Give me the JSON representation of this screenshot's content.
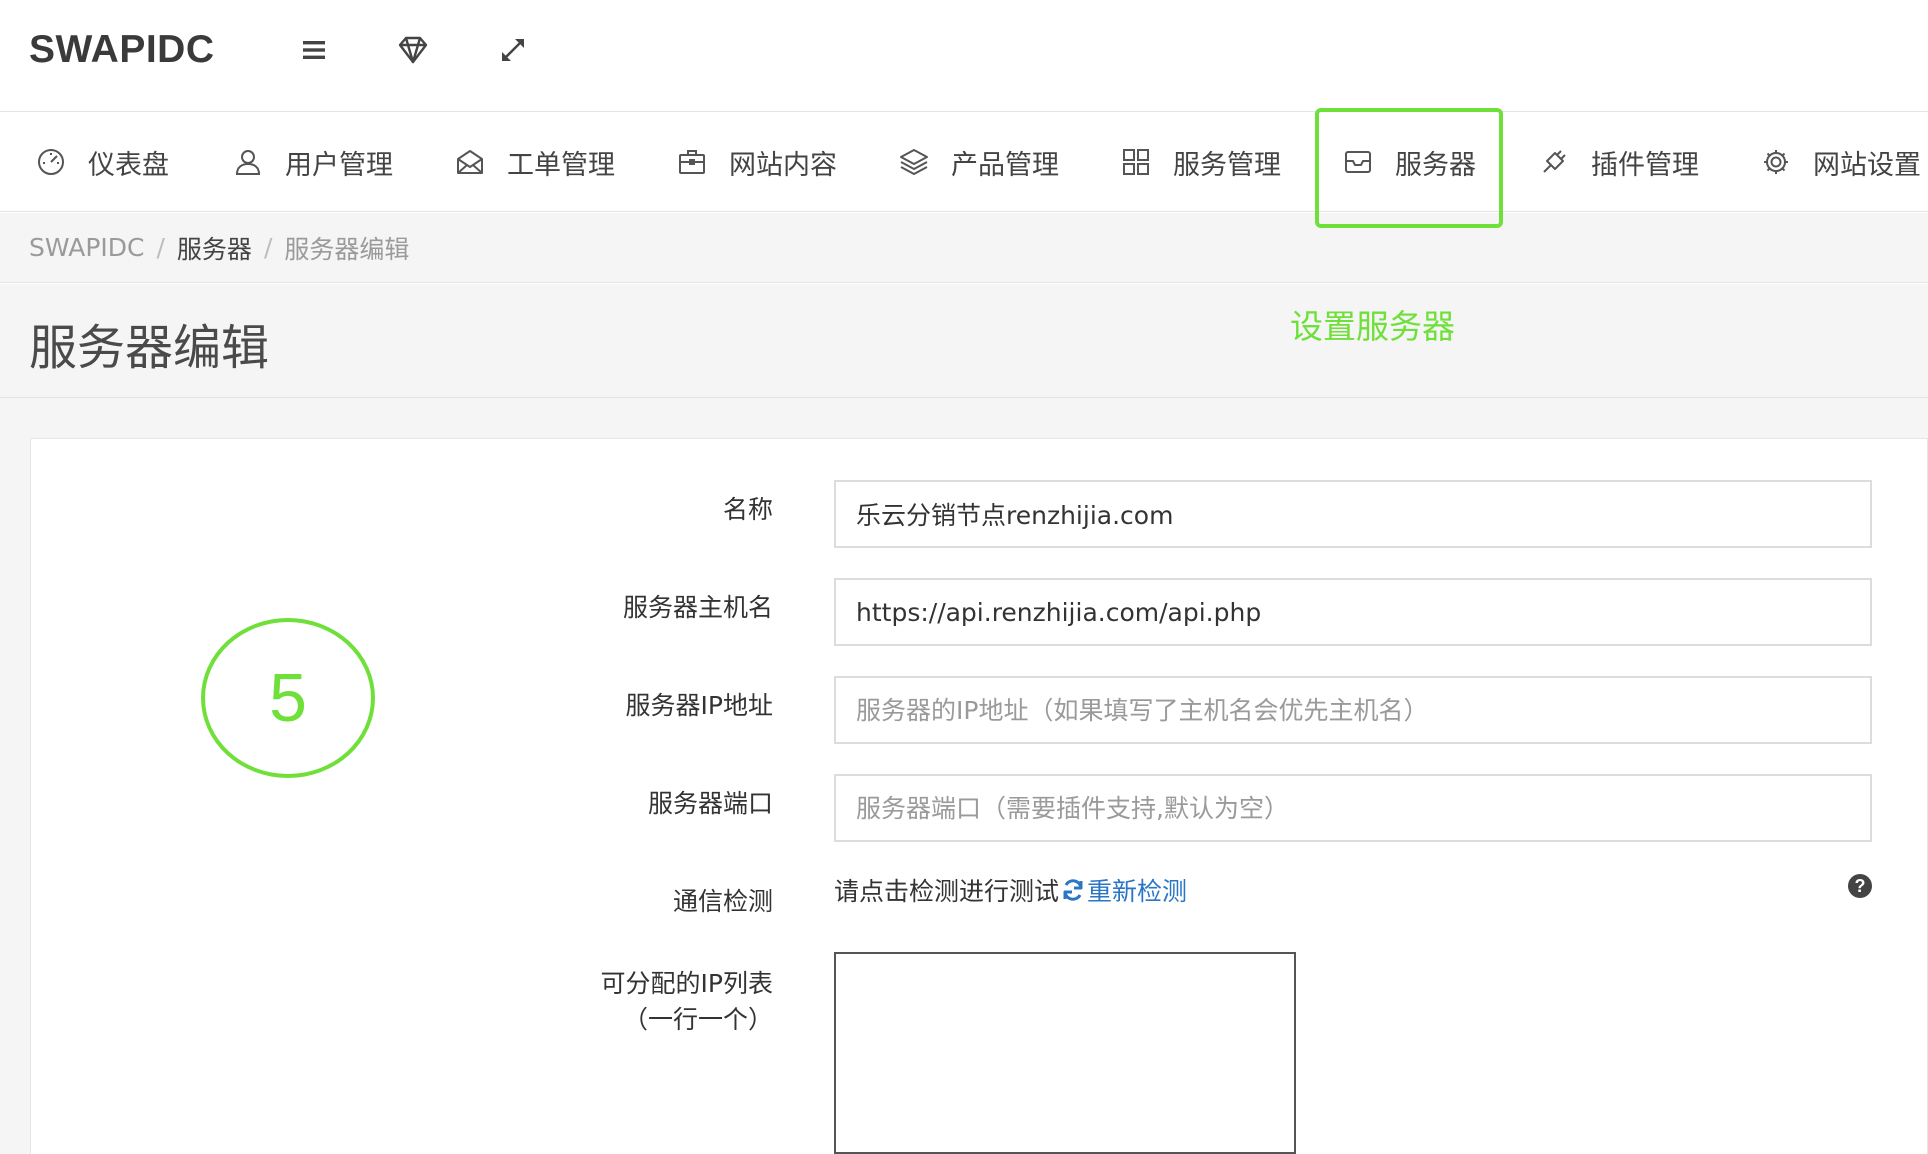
{
  "header": {
    "brand": "SWAPIDC",
    "icons": [
      "menu-icon",
      "diamond-icon",
      "expand-icon"
    ]
  },
  "nav": {
    "items": [
      {
        "label": "仪表盘",
        "icon": "dashboard-icon"
      },
      {
        "label": "用户管理",
        "icon": "user-icon"
      },
      {
        "label": "工单管理",
        "icon": "envelope-icon"
      },
      {
        "label": "网站内容",
        "icon": "briefcase-icon"
      },
      {
        "label": "产品管理",
        "icon": "layers-icon"
      },
      {
        "label": "服务管理",
        "icon": "grid-icon"
      },
      {
        "label": "服务器",
        "icon": "inbox-icon"
      },
      {
        "label": "插件管理",
        "icon": "plug-icon"
      },
      {
        "label": "网站设置",
        "icon": "gear-icon"
      }
    ],
    "highlight_color": "#6fe03a"
  },
  "breadcrumb": {
    "items": [
      "SWAPIDC",
      "服务器",
      "服务器编辑"
    ],
    "separator": "/"
  },
  "page": {
    "title": "服务器编辑",
    "annotation": "设置服务器",
    "step": "5"
  },
  "form": {
    "name": {
      "label": "名称",
      "value": "乐云分销节点renzhijia.com",
      "placeholder": ""
    },
    "hostname": {
      "label": "服务器主机名",
      "value": "https://api.renzhijia.com/api.php",
      "placeholder": ""
    },
    "ip": {
      "label": "服务器IP地址",
      "value": "",
      "placeholder": "服务器的IP地址（如果填写了主机名会优先主机名）"
    },
    "port": {
      "label": "服务器端口",
      "value": "",
      "placeholder": "服务器端口（需要插件支持,默认为空）"
    },
    "check": {
      "label": "通信检测",
      "text": "请点击检测进行测试",
      "link": "重新检测"
    },
    "ip_list": {
      "label_line1": "可分配的IP列表",
      "label_line2": "（一行一个）",
      "value": ""
    }
  }
}
